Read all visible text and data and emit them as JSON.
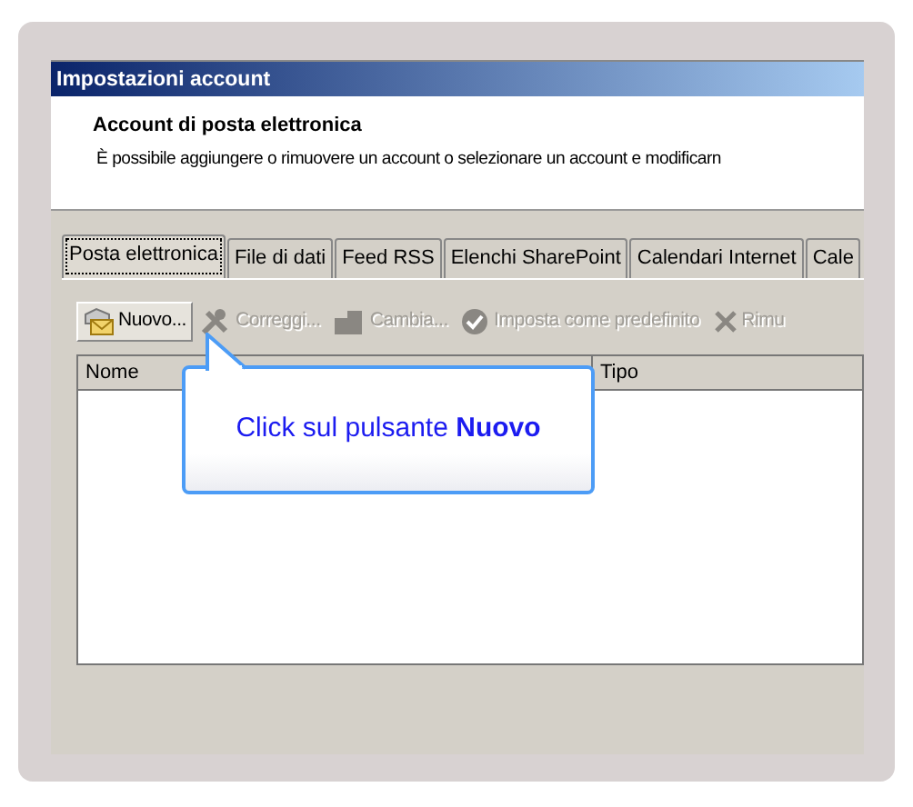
{
  "window": {
    "title": "Impostazioni account"
  },
  "header": {
    "title": "Account di posta elettronica",
    "description": "È possibile aggiungere o rimuovere un account o selezionare un account e modificarn"
  },
  "tabs": [
    {
      "label": "Posta elettronica",
      "selected": true
    },
    {
      "label": "File di dati",
      "selected": false
    },
    {
      "label": "Feed RSS",
      "selected": false
    },
    {
      "label": "Elenchi SharePoint",
      "selected": false
    },
    {
      "label": "Calendari Internet",
      "selected": false
    },
    {
      "label": "Cale",
      "selected": false
    }
  ],
  "toolbar": [
    {
      "kind": "new",
      "label": "Nuovo...",
      "disabled": false
    },
    {
      "kind": "repair",
      "label": "Correggi...",
      "disabled": true
    },
    {
      "kind": "change",
      "label": "Cambia...",
      "disabled": true
    },
    {
      "kind": "default",
      "label": "Imposta come predefinito",
      "disabled": true
    },
    {
      "kind": "remove",
      "label": "Rimu",
      "disabled": true
    }
  ],
  "list": {
    "columns": [
      "Nome",
      "Tipo"
    ]
  },
  "callout": {
    "text": "Click sul pulsante **Nuovo**"
  }
}
